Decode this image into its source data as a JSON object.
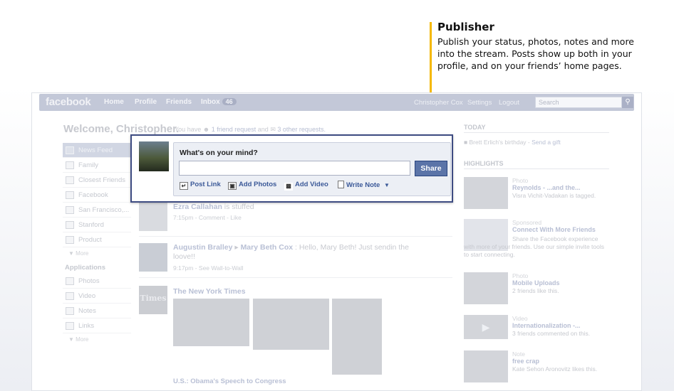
{
  "callout": {
    "title": "Publisher",
    "body": "Publish your status, photos, notes and more into the stream. Posts show up both in your profile, and on your friends’ home pages."
  },
  "topbar": {
    "logo": "facebook",
    "nav": [
      "Home",
      "Profile",
      "Friends",
      "Inbox"
    ],
    "inbox_count": "46",
    "user_name": "Christopher Cox",
    "settings": "Settings",
    "logout": "Logout",
    "search_placeholder": "Search"
  },
  "welcome": {
    "title": "Welcome, Christopher.",
    "requests_prefix": "You have",
    "friend_requests": "1 friend request",
    "and": "and",
    "other_requests": "3 other requests."
  },
  "leftnav": {
    "items": [
      "News Feed",
      "Family",
      "Closest Friends",
      "Facebook",
      "San Francisco,...",
      "Stanford",
      "Product"
    ],
    "more": "More",
    "apps_heading": "Applications",
    "apps": [
      "Photos",
      "Video",
      "Notes",
      "Links"
    ],
    "apps_more": "More"
  },
  "publisher": {
    "prompt": "What's on your mind?",
    "input_value": "",
    "share": "Share",
    "actions": [
      "Post Link",
      "Add Photos",
      "Add Video",
      "Write Note"
    ],
    "more_icon": "chevron-down-icon"
  },
  "feed": {
    "story1": {
      "name": "Ezra Callahan",
      "text": "is stuffed",
      "meta": "7:15pm - Comment - Like"
    },
    "story2": {
      "from": "Augustin Bralley",
      "to": "Mary Beth Cox",
      "text": ": Hello, Mary Beth! Just sendin the loove!!",
      "meta": "9:17pm - See Wall-to-Wall"
    },
    "story3": {
      "name": "The New York Times",
      "logo": "Times",
      "caption": "U.S.: Obama's Speech to Congress"
    }
  },
  "rightcol": {
    "today_heading": "TODAY",
    "birthday_text": "Brett Erlich's birthday -",
    "birthday_link": "Send a gift",
    "highlights_heading": "HIGHLIGHTS",
    "items": [
      {
        "type": "Photo",
        "title": "Reynolds - ...and the...",
        "desc": "Visra Vichit-Vadakan is tagged."
      },
      {
        "type": "Sponsored",
        "title": "Connect With More Friends",
        "desc": "Share the Facebook experience with more of your friends. Use our simple invite tools to start connecting."
      },
      {
        "type": "Photo",
        "title": "Mobile Uploads",
        "desc": "2 friends like this."
      },
      {
        "type": "Video",
        "title": "Internationalization -...",
        "desc": "3 friends commented on this."
      },
      {
        "type": "Note",
        "title": "free crap",
        "desc": "Kate Sehon Aronovitz likes this."
      }
    ]
  },
  "colors": {
    "accent": "#f5b800",
    "brand": "#3b5998",
    "share_button": "#5b74a8"
  }
}
